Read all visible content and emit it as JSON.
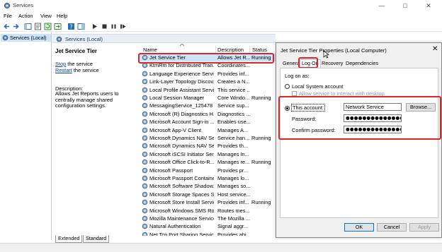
{
  "window": {
    "title": "Services"
  },
  "menubar": {
    "items": [
      "File",
      "Action",
      "View",
      "Help"
    ]
  },
  "tree": {
    "root": "Services (Local)"
  },
  "header_strip": {
    "title": "Services (Local)"
  },
  "description": {
    "service_title": "Jet Service Tier",
    "stop_link": "Stop",
    "stop_suffix": " the service",
    "restart_link": "Restart",
    "restart_suffix": " the service",
    "desc_label": "Description:",
    "desc_text": "Allows Jet Reports users to centrally manage shared configuration settings."
  },
  "list": {
    "columns": {
      "name": "Name",
      "description": "Description",
      "status": "Status"
    },
    "rows": [
      {
        "name": "Jet Service Tier",
        "desc": "Allows Jet R...",
        "status": "Running"
      },
      {
        "name": "KtmRm for Distributed Tran...",
        "desc": "Coordinates...",
        "status": ""
      },
      {
        "name": "Language Experience Service",
        "desc": "Provides inf...",
        "status": ""
      },
      {
        "name": "Link-Layer Topology Discov...",
        "desc": "Creates a N...",
        "status": ""
      },
      {
        "name": "Local Profile Assistant Service",
        "desc": "This service ...",
        "status": ""
      },
      {
        "name": "Local Session Manager",
        "desc": "Core Windo...",
        "status": "Running"
      },
      {
        "name": "MessagingService_125478",
        "desc": "Service sup...",
        "status": ""
      },
      {
        "name": "Microsoft (R) Diagnostics H...",
        "desc": "Diagnostics ...",
        "status": ""
      },
      {
        "name": "Microsoft Account Sign-in ...",
        "desc": "Enables use...",
        "status": ""
      },
      {
        "name": "Microsoft App-V Client",
        "desc": "Manages A...",
        "status": ""
      },
      {
        "name": "Microsoft Dynamics NAV Se...",
        "desc": "Service han...",
        "status": "Running"
      },
      {
        "name": "Microsoft Dynamics NAV Se...",
        "desc": "Provides th...",
        "status": ""
      },
      {
        "name": "Microsoft iSCSI Initiator Ser...",
        "desc": "Manages In...",
        "status": ""
      },
      {
        "name": "Microsoft Office Click-to-R...",
        "desc": "Manages re...",
        "status": "Running"
      },
      {
        "name": "Microsoft Passport",
        "desc": "Provides pr...",
        "status": ""
      },
      {
        "name": "Microsoft Passport Container",
        "desc": "Manages lo...",
        "status": ""
      },
      {
        "name": "Microsoft Software Shadow...",
        "desc": "Manages so...",
        "status": ""
      },
      {
        "name": "Microsoft Storage Spaces S...",
        "desc": "Host service...",
        "status": ""
      },
      {
        "name": "Microsoft Store Install Service",
        "desc": "Provides inf...",
        "status": "Running"
      },
      {
        "name": "Microsoft Windows SMS Ro...",
        "desc": "Routes mes...",
        "status": ""
      },
      {
        "name": "Mozilla Maintenance Service",
        "desc": "The Mozilla ...",
        "status": ""
      },
      {
        "name": "Natural Authentication",
        "desc": "Signal aggr...",
        "status": ""
      },
      {
        "name": "Net.Tcp Port Sharing Service",
        "desc": "Provides abi...",
        "status": ""
      }
    ]
  },
  "bottom_tabs": [
    "Extended",
    "Standard"
  ],
  "dialog": {
    "title": "Jet Service Tier Properties (Local Computer)",
    "tabs": [
      "General",
      "Log On",
      "Recovery",
      "Dependencies"
    ],
    "logon_as": "Log on as:",
    "local_system": "Local System account",
    "allow_interact": "Allow service to interact with desktop",
    "this_account": "This account:",
    "account_value": "Network Service",
    "browse": "Browse...",
    "password_label": "Password:",
    "password_value": "●●●●●●●●●●●●●●●",
    "confirm_label": "Confirm password:",
    "confirm_value": "●●●●●●●●●●●●●●●",
    "ok": "OK",
    "cancel": "Cancel",
    "apply": "Apply"
  },
  "colors": {
    "highlight": "#e0242c",
    "selection": "#cce4f7",
    "link": "#0645ad"
  }
}
